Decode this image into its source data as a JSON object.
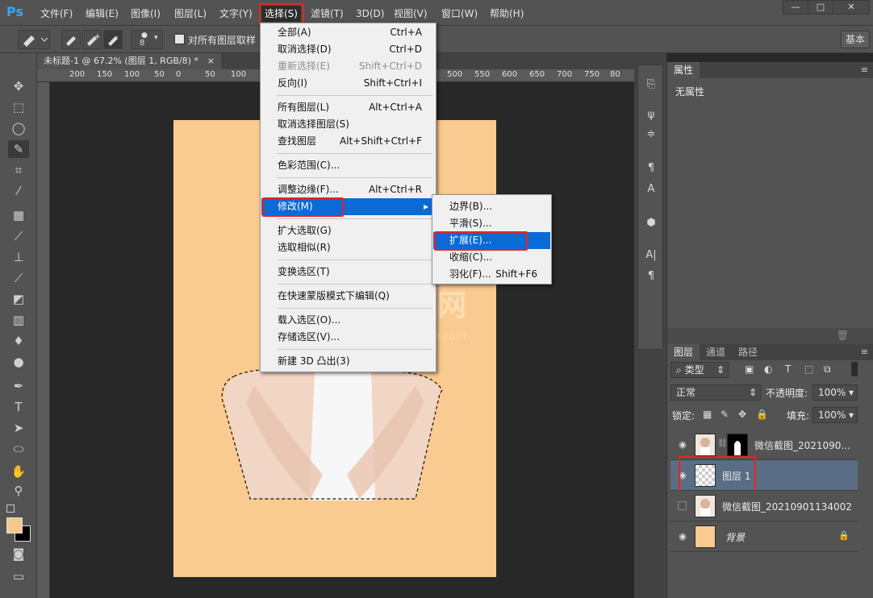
{
  "app": {
    "logo": "Ps"
  },
  "menubar": {
    "items": [
      {
        "label": "文件(F)"
      },
      {
        "label": "编辑(E)"
      },
      {
        "label": "图像(I)"
      },
      {
        "label": "图层(L)"
      },
      {
        "label": "文字(Y)"
      },
      {
        "label": "选择(S)"
      },
      {
        "label": "滤镜(T)"
      },
      {
        "label": "3D(D)"
      },
      {
        "label": "视图(V)"
      },
      {
        "label": "窗口(W)"
      },
      {
        "label": "帮助(H)"
      }
    ],
    "window_buttons": {
      "minimize": "—",
      "restore": "□",
      "close": "✕"
    }
  },
  "options": {
    "brush_size": "8",
    "sample_all_label": "对所有图层取样",
    "workspace_label": "基本"
  },
  "document": {
    "tab_title": "未标题-1 @ 67.2% (图层 1, RGB/8) *",
    "tab_close": "×",
    "ruler_labels": [
      "200",
      "150",
      "100",
      "50",
      "0",
      "50",
      "100",
      "500",
      "550",
      "600",
      "650",
      "700",
      "750",
      "80"
    ],
    "watermark": "渴复网",
    "watermark_url": "www.xiaw.com"
  },
  "select_menu": {
    "items": [
      {
        "label": "全部(A)",
        "shortcut": "Ctrl+A",
        "disabled": false
      },
      {
        "label": "取消选择(D)",
        "shortcut": "Ctrl+D",
        "disabled": false
      },
      {
        "label": "重新选择(E)",
        "shortcut": "Shift+Ctrl+D",
        "disabled": true
      },
      {
        "label": "反向(I)",
        "shortcut": "Shift+Ctrl+I",
        "disabled": false
      },
      {
        "label": "所有图层(L)",
        "shortcut": "Alt+Ctrl+A",
        "disabled": false
      },
      {
        "label": "取消选择图层(S)",
        "shortcut": "",
        "disabled": false
      },
      {
        "label": "查找图层",
        "shortcut": "Alt+Shift+Ctrl+F",
        "disabled": false
      },
      {
        "label": "色彩范围(C)...",
        "shortcut": "",
        "disabled": false
      },
      {
        "label": "调整边缘(F)...",
        "shortcut": "Alt+Ctrl+R",
        "disabled": false
      },
      {
        "label": "修改(M)",
        "shortcut": "",
        "disabled": false,
        "highlighted": true
      },
      {
        "label": "扩大选取(G)",
        "shortcut": "",
        "disabled": false
      },
      {
        "label": "选取相似(R)",
        "shortcut": "",
        "disabled": false
      },
      {
        "label": "变换选区(T)",
        "shortcut": "",
        "disabled": false
      },
      {
        "label": "在快速蒙版模式下编辑(Q)",
        "shortcut": "",
        "disabled": false
      },
      {
        "label": "载入选区(O)...",
        "shortcut": "",
        "disabled": false
      },
      {
        "label": "存储选区(V)...",
        "shortcut": "",
        "disabled": false
      },
      {
        "label": "新建 3D 凸出(3)",
        "shortcut": "",
        "disabled": false
      }
    ],
    "submenu_arrow": "▸"
  },
  "modify_submenu": {
    "items": [
      {
        "label": "边界(B)...",
        "shortcut": ""
      },
      {
        "label": "平滑(S)...",
        "shortcut": ""
      },
      {
        "label": "扩展(E)...",
        "shortcut": "",
        "highlighted": true
      },
      {
        "label": "收缩(C)...",
        "shortcut": ""
      },
      {
        "label": "羽化(F)...",
        "shortcut": "Shift+F6"
      }
    ]
  },
  "properties_panel": {
    "tab": "属性",
    "empty_text": "无属性"
  },
  "layers_panel": {
    "tabs": [
      "图层",
      "通道",
      "路径"
    ],
    "filter_label": "类型",
    "blend_mode": "正常",
    "opacity_label": "不透明度:",
    "opacity_value": "100%",
    "lock_label": "锁定:",
    "fill_label": "填充:",
    "fill_value": "100%",
    "layers": [
      {
        "name": "微信截图_2021090...",
        "visible": true,
        "selected": false
      },
      {
        "name": "图层 1",
        "visible": true,
        "selected": true
      },
      {
        "name": "微信截图_20210901134002",
        "visible": false,
        "selected": false
      },
      {
        "name": "背景",
        "visible": true,
        "selected": false,
        "locked": true
      }
    ]
  },
  "colors": {
    "accent_red": "#e8231f",
    "highlight_blue": "#0a6ad6",
    "canvas_bg": "#facb90",
    "selected_layer": "#5a6d84"
  }
}
